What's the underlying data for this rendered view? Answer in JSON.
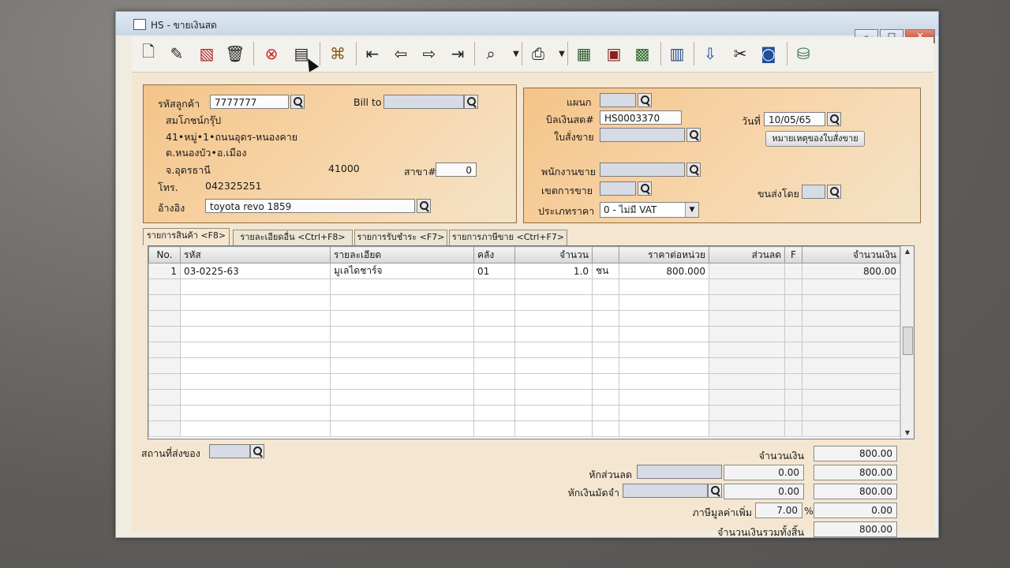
{
  "window": {
    "title": "HS - ขายเงินสด",
    "controls": {
      "minimize": "–",
      "maximize": "□",
      "close": "✕"
    }
  },
  "toolbar": {
    "icons": [
      "new-doc-icon",
      "edit-icon",
      "delete-doc-icon",
      "trash-icon",
      "cancel-icon",
      "save-icon",
      "print-preview-icon",
      "first-record-icon",
      "prev-record-icon",
      "next-record-icon",
      "last-record-icon",
      "search-icon",
      "printer-icon",
      "report-icon",
      "calculator-icon",
      "chart-icon",
      "approve-icon",
      "ok-icon",
      "tools-icon",
      "ok-disk-icon",
      "database-icon"
    ]
  },
  "customer": {
    "code_label": "รหัสลูกค้า",
    "code": "7777777",
    "name": "สมโภชน์กรุ๊ป",
    "address1": "41•หมู่•1•ถนนอุดร-หนองคาย",
    "address2": "ต.หนองบัว•อ.เมือง",
    "address3": "จ.อุดรธานี",
    "postcode": "41000",
    "branch_label": "สาขา#",
    "branch": "0",
    "phone_label": "โทร.",
    "phone": "042325251",
    "reference_label": "อ้างอิง",
    "reference": "toyota revo 1859",
    "bill_to_label": "Bill to"
  },
  "document": {
    "department_label": "แผนก",
    "bill_no_label": "บิลเงินสด#",
    "bill_no": "HS0003370",
    "date_label": "วันที่",
    "date": "10/05/65",
    "sales_order_label": "ใบสั่งขาย",
    "order_note_button": "หมายเหตุของใบสั่งขาย",
    "salesperson_label": "พนักงานขาย",
    "sales_area_label": "เขตการขาย",
    "shipped_by_label": "ขนส่งโดย",
    "price_type_label": "ประเภทราคา",
    "price_type": "0 - ไม่มี VAT"
  },
  "tabs": [
    {
      "label": "รายการสินค้า <F8>"
    },
    {
      "label": "รายละเอียดอื่น <Ctrl+F8>"
    },
    {
      "label": "รายการรับชำระ <F7>"
    },
    {
      "label": "รายการภาษีขาย <Ctrl+F7>"
    }
  ],
  "table": {
    "headers": [
      "No.",
      "รหัส",
      "รายละเอียด",
      "คลัง",
      "จำนวน",
      "",
      "ราคาต่อหน่วย",
      "ส่วนลด",
      "F",
      "จำนวนเงิน"
    ],
    "rows": [
      [
        "1",
        "03-0225-63",
        "มูเลไดชาร์จ",
        "01",
        "1.0",
        "ชน",
        "800.000",
        "",
        "",
        "800.00"
      ]
    ]
  },
  "totals": {
    "ship_to_label": "สถานที่ส่งของ",
    "amount_label": "จำนวนเงิน",
    "amount": "800.00",
    "discount_label": "หักส่วนลด",
    "discount": "0.00",
    "after_discount": "800.00",
    "deposit_label": "หักเงินมัดจำ",
    "deposit": "0.00",
    "after_deposit": "800.00",
    "vat_label": "ภาษีมูลค่าเพิ่ม",
    "vat_rate": "7.00",
    "vat_percent": "%",
    "vat_amount": "0.00",
    "grand_total_label": "จำนวนเงินรวมทั้งสิ้น",
    "grand_total": "800.00"
  }
}
